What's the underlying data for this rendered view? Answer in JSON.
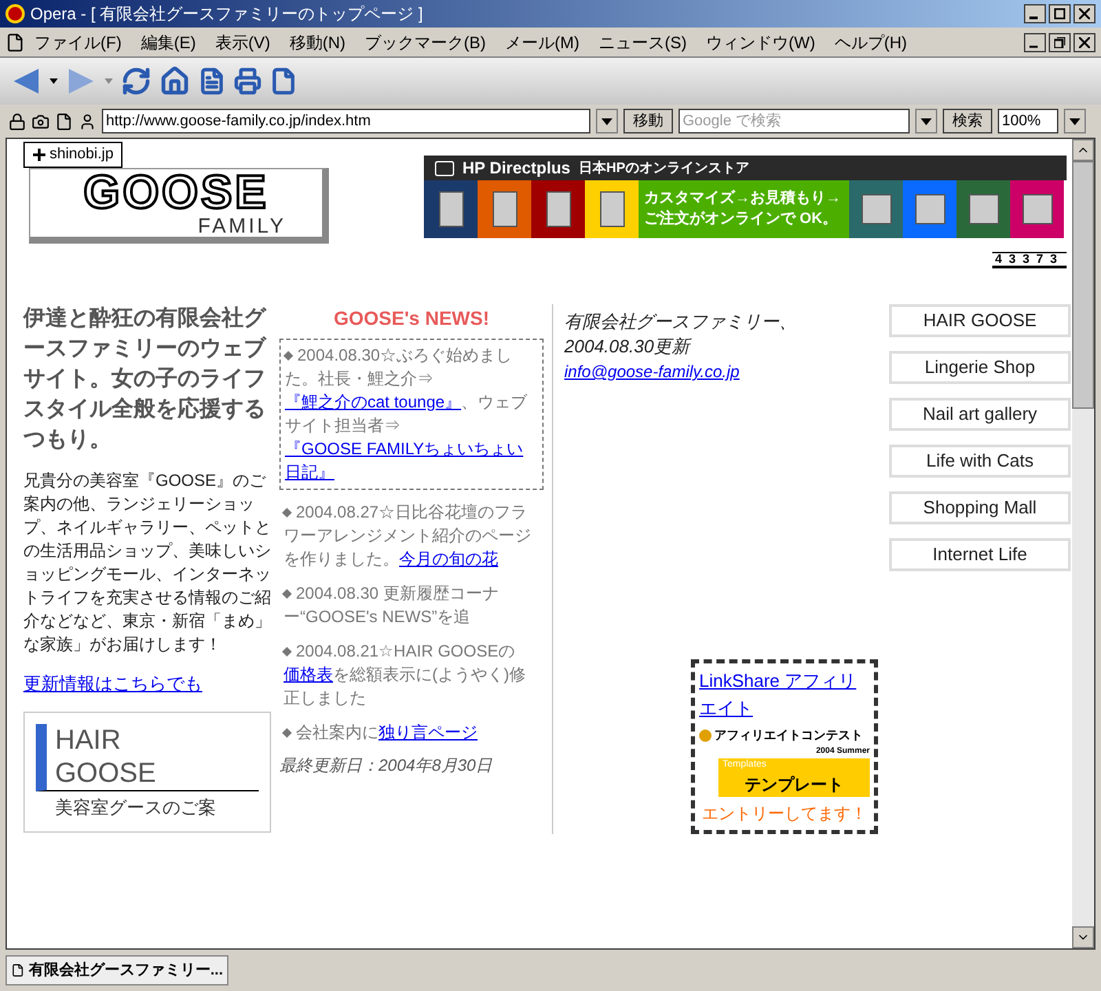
{
  "window": {
    "title": "Opera - [ 有限会社グースファミリーのトップページ ]"
  },
  "menu": [
    "ファイル(F)",
    "編集(E)",
    "表示(V)",
    "移動(N)",
    "ブックマーク(B)",
    "メール(M)",
    "ニュース(S)",
    "ウィンドウ(W)",
    "ヘルプ(H)"
  ],
  "address_bar": {
    "url": "http://www.goose-family.co.jp/index.htm",
    "go_button": "移動",
    "search_placeholder": "Google で検索",
    "search_button": "検索",
    "zoom": "100%"
  },
  "page": {
    "badge": "shinobi.jp",
    "logo": {
      "title": "GOOSE",
      "subtitle": "FAMILY"
    },
    "banner": {
      "brand": "HP Directplus",
      "tagline": "日本HPのオンラインストア",
      "lines": [
        "カスタマイズ→お見積もり→",
        "ご注文がオンラインで OK。"
      ]
    },
    "counter": "43373",
    "intro": "伊達と酔狂の有限会社グースファミリーのウェブサイト。女の子のライフスタイル全般を応援するつもり。",
    "description": "兄貴分の美容室『GOOSE』のご案内の他、ランジェリーショップ、ネイルギャラリー、ペットとの生活用品ショップ、美味しいショッピングモール、インターネットライフを充実させる情報のご紹介などなど、東京・新宿「まめ」な家族」がお届けします！",
    "updates_link": "更新情報はこちらでも",
    "hair_card": {
      "title_lines": [
        "HAIR",
        "GOOSE"
      ],
      "text": "美容室グースのご案"
    },
    "news": {
      "title": "GOOSE's NEWS!",
      "items": [
        {
          "parts": [
            {
              "text": "2004.08.30☆ぶろぐ始めました。社長・鯉之介⇒",
              "link": false
            },
            {
              "text": "『鯉之介のcat tounge』",
              "link": true
            },
            {
              "text": "、ウェブサイト担当者⇒",
              "link": false
            },
            {
              "text": "『GOOSE FAMILYちょいちょい日記』",
              "link": true
            }
          ]
        },
        {
          "parts": [
            {
              "text": "2004.08.27☆日比谷花壇のフラワーアレンジメント紹介のページを作りました。",
              "link": false
            },
            {
              "text": "今月の旬の花",
              "link": true
            }
          ]
        },
        {
          "parts": [
            {
              "text": "2004.08.30 更新履歴コーナー“GOOSE's NEWS”を追",
              "link": false
            }
          ]
        },
        {
          "parts": [
            {
              "text": "2004.08.21☆HAIR GOOSEの",
              "link": false
            },
            {
              "text": "価格表",
              "link": true
            },
            {
              "text": "を総額表示に(ようやく)修正しました",
              "link": false
            }
          ]
        },
        {
          "parts": [
            {
              "text": "会社案内に",
              "link": false
            },
            {
              "text": "独り言ページ",
              "link": true
            }
          ]
        }
      ],
      "last_updated": "最終更新日：2004年8月30日"
    },
    "company": {
      "line": "有限会社グースファミリー、2004.08.30更新",
      "email": "info@goose-family.co.jp"
    },
    "nav": [
      "HAIR GOOSE",
      "Lingerie Shop",
      "Nail art gallery",
      "Life with Cats",
      "Shopping Mall",
      "Internet Life"
    ],
    "affiliate": {
      "link": "LinkShare アフィリエイト",
      "contest": "アフィリエイトコンテスト",
      "season": "2004 Summer",
      "tag": "Templates",
      "label": "テンプレート",
      "entry": "エントリーしてます！"
    }
  },
  "taskbar": {
    "tab": "有限会社グースファミリー..."
  }
}
